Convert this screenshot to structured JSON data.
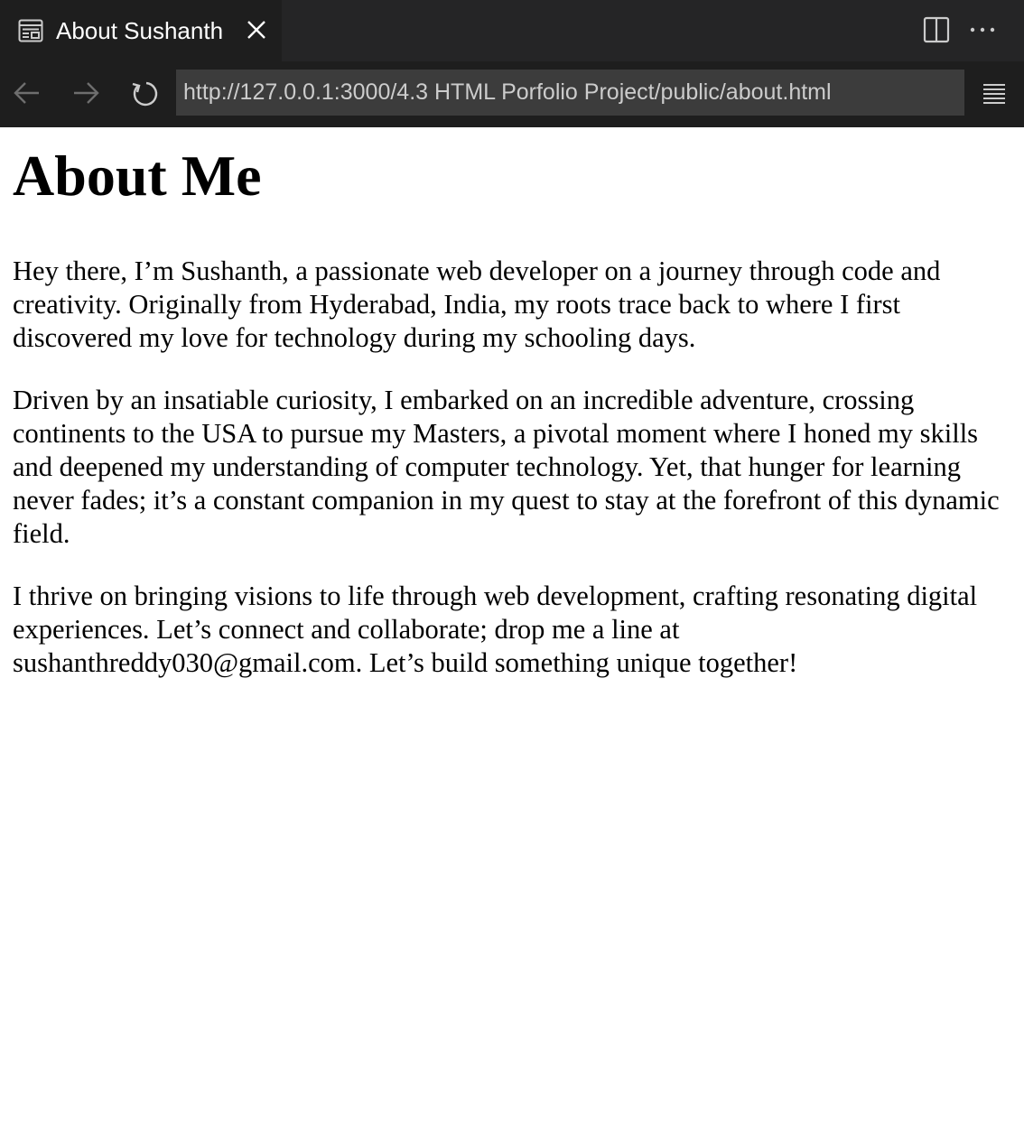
{
  "tab": {
    "title": "About Sushanth",
    "icon": "preview-icon"
  },
  "toolbar": {
    "url": "http://127.0.0.1:3000/4.3 HTML Porfolio Project/public/about.html"
  },
  "page": {
    "heading": "About Me",
    "paragraphs": [
      "Hey there, I’m Sushanth, a passionate web developer on a journey through code and creativity. Originally from Hyderabad, India, my roots trace back to where I first discovered my love for technology during my schooling days.",
      "Driven by an insatiable curiosity, I embarked on an incredible adventure, crossing continents to the USA to pursue my Masters, a pivotal moment where I honed my skills and deepened my understanding of computer technology. Yet, that hunger for learning never fades; it’s a constant companion in my quest to stay at the forefront of this dynamic field.",
      "I thrive on bringing visions to life through web development, crafting resonating digital experiences. Let’s connect and collaborate; drop me a line at sushanthreddy030@gmail.com. Let’s build something unique together!"
    ]
  },
  "colors": {
    "tabbar_bg": "#252526",
    "active_tab_bg": "#1e1e1e",
    "url_bg": "#3c3c3c",
    "url_text": "#cccccc",
    "icon": "#cccccc",
    "icon_dim": "#8a8a8a"
  }
}
